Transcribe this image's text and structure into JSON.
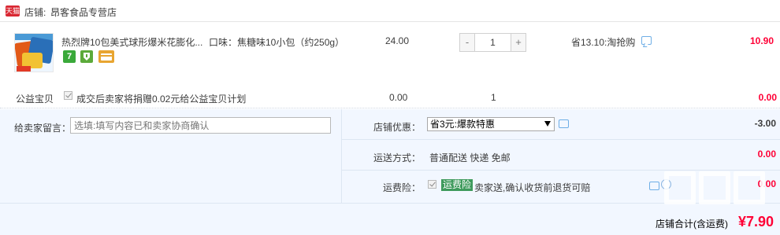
{
  "shop": {
    "badge": "天猫",
    "label": "店铺:",
    "name": "昂客食品专营店"
  },
  "item": {
    "image_name": "product-thumbnail",
    "title": "热烈牌10包美式球形爆米花膨化...",
    "sku": "口味：焦糖味10小包（约250g）",
    "unit_price": "24.00",
    "quantity": "1",
    "minus_label": "-",
    "plus_label": "+",
    "promotion": "省13.10:淘抢购",
    "subtotal": "10.90",
    "service_icons": [
      "seven-day-return-icon",
      "guarantee-icon",
      "credit-card-icon"
    ],
    "service_seven": "7"
  },
  "charity": {
    "label": "公益宝贝",
    "text": "成交后卖家将捐赠0.02元给公益宝贝计划",
    "price": "0.00",
    "quantity": "1",
    "total": "0.00"
  },
  "order_options": {
    "message_label": "给卖家留言：",
    "message_placeholder": "选填:填写内容已和卖家协商确认",
    "discount_label": "店铺优惠：",
    "discount_selected": "省3元:爆款特惠",
    "discount_amount": "-3.00",
    "shipping_label": "运送方式：",
    "shipping_method": "普通配送 快递 免邮",
    "shipping_amount": "0.00",
    "insurance_label": "运费险：",
    "insurance_badge": "运费险",
    "insurance_text": "卖家送,确认收货前退货可赔",
    "insurance_amount": "0.00"
  },
  "summary": {
    "total_label": "店铺合计(含运费)",
    "total_amount": "¥7.90"
  },
  "colors": {
    "price_red": "#ff0036",
    "tmall_red": "#d92732",
    "panel_bg": "#f2f7ff",
    "insurance_green": "#3e9a5c"
  }
}
